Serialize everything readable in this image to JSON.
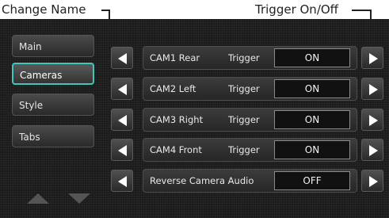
{
  "callouts": {
    "left": "Change Name",
    "right": "Trigger On/Off"
  },
  "sidebar": {
    "items": [
      {
        "label": "Main",
        "selected": false
      },
      {
        "label": "Cameras",
        "selected": true
      },
      {
        "label": "Style",
        "selected": false
      },
      {
        "label": "Tabs",
        "selected": false
      }
    ],
    "scroll_up_icon": "triangle-up-icon",
    "scroll_down_icon": "triangle-down-icon"
  },
  "rows": [
    {
      "name": "CAM1 Rear",
      "kind": "Trigger",
      "value": "ON"
    },
    {
      "name": "CAM2 Left",
      "kind": "Trigger",
      "value": "ON"
    },
    {
      "name": "CAM3 Right",
      "kind": "Trigger",
      "value": "ON"
    },
    {
      "name": "CAM4 Front",
      "kind": "Trigger",
      "value": "ON"
    },
    {
      "name": "Reverse Camera Audio",
      "kind": "",
      "value": "OFF"
    }
  ],
  "colors": {
    "selected_border": "#3fc7b8",
    "background": "#1b1b1b",
    "arrow": "#ffffff"
  }
}
